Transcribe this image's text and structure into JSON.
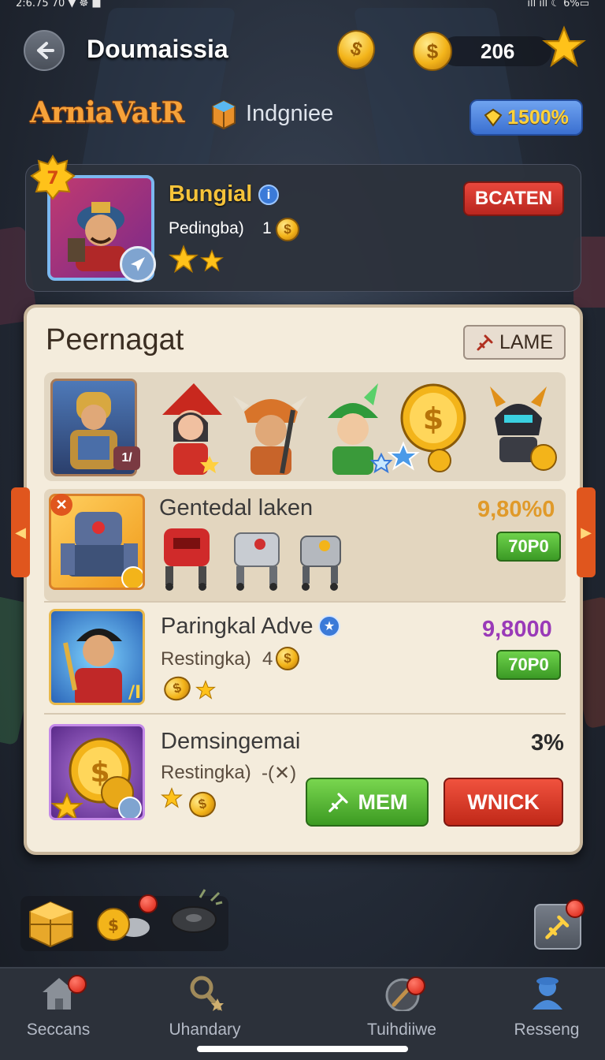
{
  "status_bar": {
    "left": "2:6.75 70 ▼ ☸ ■",
    "right": "ıll ıll ☾ 6%▭"
  },
  "header": {
    "title": "Doumaissia",
    "currency_value": "206",
    "coin_glyph": "$"
  },
  "subheader": {
    "logo": "ArniaVatR",
    "crate_label": "Indgniee",
    "gem_value": "1500%"
  },
  "profile": {
    "level_badge": "7",
    "name": "Bungial",
    "info_glyph": "i",
    "rank_label": "Pedingba)",
    "rank_value": "1",
    "stars": 2,
    "action_button": "BCATEN"
  },
  "panel": {
    "title": "Peernagat",
    "lame_button": "LAME",
    "first_char_level": "1/",
    "rows": [
      {
        "name": "Gentedal laken",
        "value": "9,80%0",
        "value_color": "#e09a2a",
        "button": "70P0"
      },
      {
        "name": "Paringkal Adve",
        "sub_label": "Restingka)",
        "sub_value": "4",
        "value": "9,8000",
        "value_color": "#9a3ab8",
        "button": "70P0"
      },
      {
        "name": "Demsingemai",
        "sub_label": "Restingka)",
        "sub_value": "-(✕)",
        "value": "3%",
        "value_color": "#2a2a2a"
      }
    ],
    "mem_button": "MEM",
    "winck_button": "WNICK"
  },
  "nav": [
    {
      "label": "Seccans",
      "icon": "home-icon"
    },
    {
      "label": "Uhandary",
      "icon": "magnifier-icon"
    },
    {
      "label": "Tuihdiiwe",
      "icon": "sword-icon"
    },
    {
      "label": "Resseng",
      "icon": "profile-icon"
    }
  ]
}
